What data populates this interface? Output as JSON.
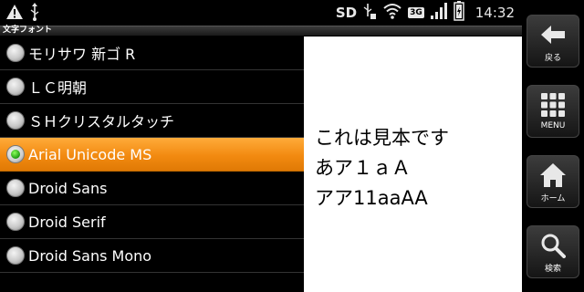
{
  "status_bar": {
    "sd_label": "SD",
    "network_badge": "3G",
    "time": "14:32",
    "icons": [
      "warning-icon",
      "usb-icon",
      "usb-debug-icon",
      "wifi-icon",
      "signal-icon",
      "battery-icon"
    ]
  },
  "title_bar": {
    "title": "文字フォント"
  },
  "font_list": {
    "selected_index": 3,
    "items": [
      {
        "label": "モリサワ 新ゴ R"
      },
      {
        "label": "ＬＣ明朝"
      },
      {
        "label": "ＳＨクリスタルタッチ"
      },
      {
        "label": "Arial Unicode MS"
      },
      {
        "label": "Droid Sans"
      },
      {
        "label": "Droid Serif"
      },
      {
        "label": "Droid Sans Mono"
      }
    ]
  },
  "preview": {
    "line1": "これは見本です",
    "line2": "あア１ａＡ",
    "line3": "アア11aaAA"
  },
  "side_buttons": {
    "back_label": "戻る",
    "menu_label": "MENU",
    "home_label": "ホーム",
    "search_label": "検索"
  },
  "colors": {
    "selected_row": "#f28a10",
    "preview_bg": "#ffffff",
    "radio_on": "#1c9a10"
  }
}
